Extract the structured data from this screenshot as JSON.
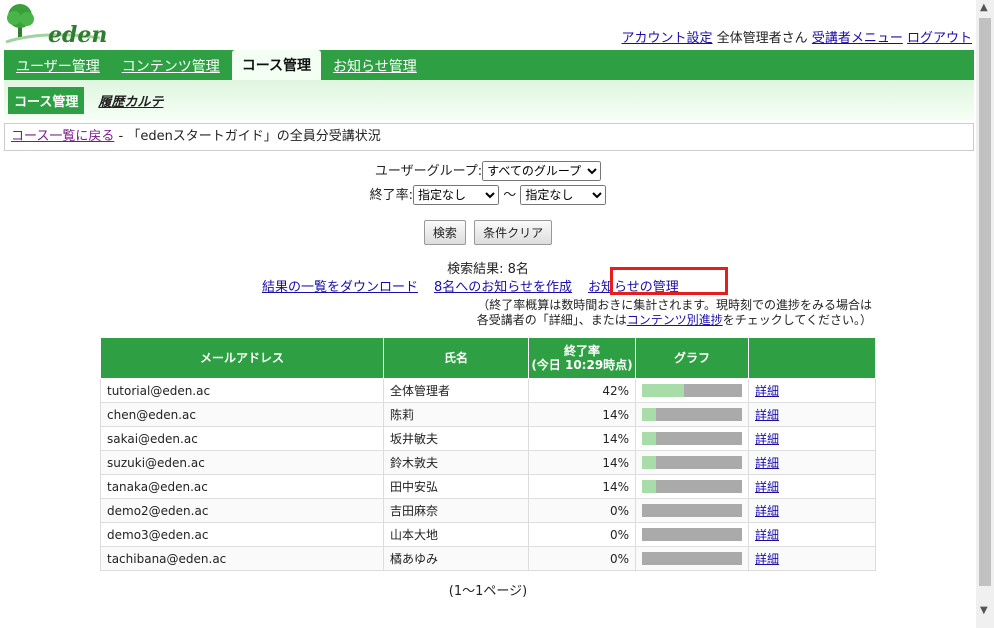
{
  "logo": {
    "text": "eden"
  },
  "toplinks": {
    "account": "アカウント設定",
    "user": "全体管理者さん",
    "learner_menu": "受講者メニュー",
    "logout": "ログアウト"
  },
  "mainnav": [
    "ユーザー管理",
    "コンテンツ管理",
    "コース管理",
    "お知らせ管理"
  ],
  "subnav": {
    "active": "コース管理",
    "other": "履歴カルテ"
  },
  "breadcrumb": {
    "back": "コース一覧に戻る",
    "title": " - 「edenスタートガイド」の全員分受講状況"
  },
  "form": {
    "group_label": "ユーザーグループ:",
    "group_value": "すべてのグループ",
    "rate_label": "終了率:",
    "rate_from": "指定なし",
    "tilde": "〜",
    "rate_to": "指定なし",
    "search": "検索",
    "clear": "条件クリア"
  },
  "results": {
    "count": "検索結果: 8名",
    "download": "結果の一覧をダウンロード",
    "notify": "8名へのお知らせを作成",
    "manage": "お知らせの管理",
    "note1": "（終了率概算は数時間おきに集計されます。現時刻での進捗をみる場合は",
    "note2_pre": "各受講者の「詳細」、または",
    "note2_link": "コンテンツ別進捗",
    "note2_post": "をチェックしてください。）"
  },
  "table": {
    "headers": [
      "メールアドレス",
      "氏名",
      "終了率",
      "(今日 10:29時点)",
      "グラフ",
      ""
    ],
    "rows": [
      {
        "email": "tutorial@eden.ac",
        "name": "全体管理者",
        "rate": "42%",
        "pct": 42,
        "detail": "詳細"
      },
      {
        "email": "chen@eden.ac",
        "name": "陈莉",
        "rate": "14%",
        "pct": 14,
        "detail": "詳細"
      },
      {
        "email": "sakai@eden.ac",
        "name": "坂井敏夫",
        "rate": "14%",
        "pct": 14,
        "detail": "詳細"
      },
      {
        "email": "suzuki@eden.ac",
        "name": "鈴木敦夫",
        "rate": "14%",
        "pct": 14,
        "detail": "詳細"
      },
      {
        "email": "tanaka@eden.ac",
        "name": "田中安弘",
        "rate": "14%",
        "pct": 14,
        "detail": "詳細"
      },
      {
        "email": "demo2@eden.ac",
        "name": "吉田麻奈",
        "rate": "0%",
        "pct": 0,
        "detail": "詳細"
      },
      {
        "email": "demo3@eden.ac",
        "name": "山本大地",
        "rate": "0%",
        "pct": 0,
        "detail": "詳細"
      },
      {
        "email": "tachibana@eden.ac",
        "name": "橘あゆみ",
        "rate": "0%",
        "pct": 0,
        "detail": "詳細"
      }
    ]
  },
  "pager": "(1〜1ページ)"
}
